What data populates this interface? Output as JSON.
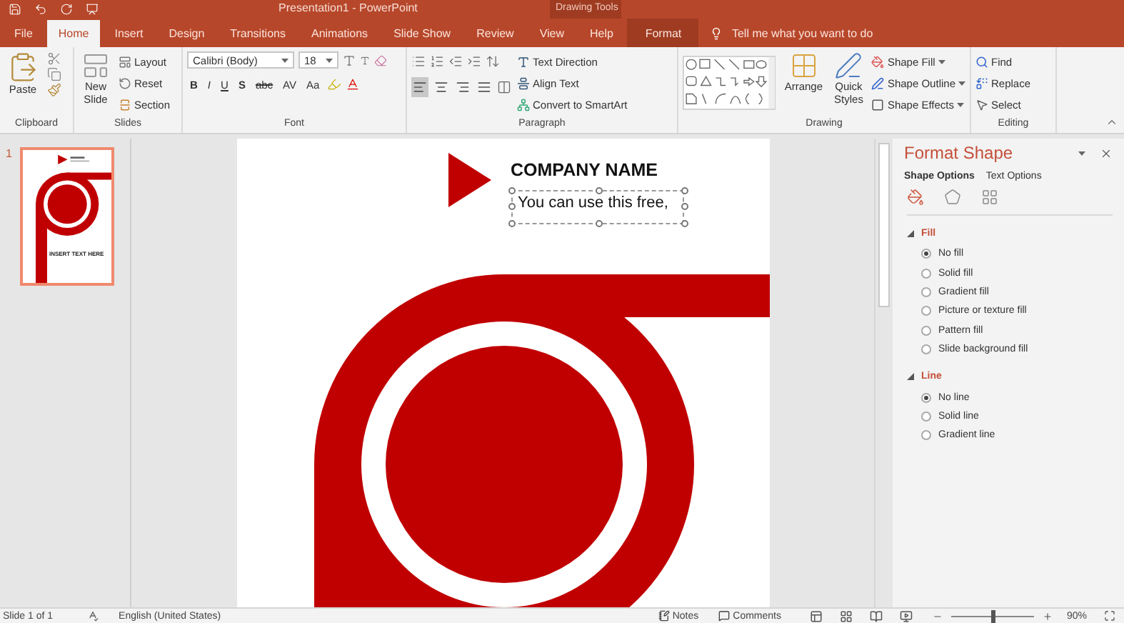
{
  "title_bar": {
    "title": "Presentation1  -  PowerPoint",
    "context_label": "Drawing Tools"
  },
  "tabs": [
    {
      "label": "File",
      "selected": false,
      "kind": "file"
    },
    {
      "label": "Home",
      "selected": true,
      "kind": "normal"
    },
    {
      "label": "Insert",
      "selected": false,
      "kind": "normal"
    },
    {
      "label": "Design",
      "selected": false,
      "kind": "normal"
    },
    {
      "label": "Transitions",
      "selected": false,
      "kind": "normal"
    },
    {
      "label": "Animations",
      "selected": false,
      "kind": "normal"
    },
    {
      "label": "Slide Show",
      "selected": false,
      "kind": "normal"
    },
    {
      "label": "Review",
      "selected": false,
      "kind": "normal"
    },
    {
      "label": "View",
      "selected": false,
      "kind": "normal"
    },
    {
      "label": "Help",
      "selected": false,
      "kind": "normal"
    },
    {
      "label": "Format",
      "selected": false,
      "kind": "context"
    }
  ],
  "tell_me": "Tell me what you want to do",
  "ribbon": {
    "clipboard": {
      "label": "Clipboard",
      "paste": "Paste"
    },
    "slides": {
      "label": "Slides",
      "new_slide": [
        "New",
        "Slide"
      ],
      "items": [
        "Layout",
        "Reset",
        "Section"
      ]
    },
    "font": {
      "label": "Font",
      "font_name": "Calibri (Body)",
      "font_size": "18",
      "format_buttons": [
        "B",
        "I",
        "U",
        "S",
        "abc",
        "AV",
        "Aa"
      ]
    },
    "paragraph": {
      "label": "Paragraph",
      "alignments": [
        {
          "selected": true
        },
        {
          "selected": false
        },
        {
          "selected": false
        },
        {
          "selected": false
        }
      ],
      "items": [
        "Text Direction",
        "Align Text",
        "Convert to SmartArt"
      ]
    },
    "drawing": {
      "label": "Drawing",
      "arrange": "Arrange",
      "quick_styles": [
        "Quick",
        "Styles"
      ],
      "items": [
        "Shape Fill",
        "Shape Outline",
        "Shape Effects"
      ]
    },
    "editing": {
      "label": "Editing",
      "items": [
        "Find",
        "Replace",
        "Select"
      ]
    }
  },
  "thumbnails": [
    {
      "number": "1",
      "selected": true,
      "caption": "INSERT TEXT HERE"
    }
  ],
  "slide": {
    "heading": "COMPANY NAME",
    "subtext": "You can use this free,"
  },
  "format_pane": {
    "title": "Format Shape",
    "tabs": [
      {
        "label": "Shape Options",
        "selected": true
      },
      {
        "label": "Text Options",
        "selected": false
      }
    ],
    "sections": [
      {
        "title": "Fill",
        "expanded": true,
        "options": [
          {
            "label": "No fill",
            "selected": true
          },
          {
            "label": "Solid fill",
            "selected": false
          },
          {
            "label": "Gradient fill",
            "selected": false
          },
          {
            "label": "Picture or texture fill",
            "selected": false
          },
          {
            "label": "Pattern fill",
            "selected": false
          },
          {
            "label": "Slide background fill",
            "selected": false
          }
        ]
      },
      {
        "title": "Line",
        "expanded": true,
        "options": [
          {
            "label": "No line",
            "selected": true
          },
          {
            "label": "Solid line",
            "selected": false
          },
          {
            "label": "Gradient line",
            "selected": false
          }
        ]
      }
    ]
  },
  "status_bar": {
    "slide_info": "Slide 1 of 1",
    "language": "English (United States)",
    "notes": "Notes",
    "comments": "Comments",
    "zoom": "90%",
    "zoom_slider": {
      "level": 0.5
    }
  }
}
